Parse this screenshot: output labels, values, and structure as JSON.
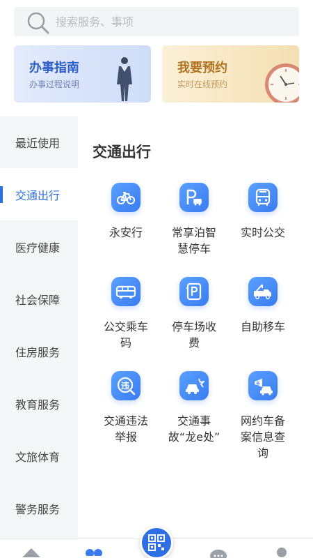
{
  "search": {
    "placeholder": "搜索服务、事项"
  },
  "banners": {
    "guide": {
      "title": "办事指南",
      "subtitle": "办事过程说明"
    },
    "booking": {
      "title": "我要预约",
      "subtitle": "实时在线预约"
    }
  },
  "sidebar": {
    "items": [
      {
        "label": "最近使用"
      },
      {
        "label": "交通出行",
        "active": true
      },
      {
        "label": "医疗健康"
      },
      {
        "label": "社会保障"
      },
      {
        "label": "住房服务"
      },
      {
        "label": "教育服务"
      },
      {
        "label": "文旅体育"
      },
      {
        "label": "警务服务"
      }
    ]
  },
  "main": {
    "section_title": "交通出行",
    "services": [
      {
        "label": "永安行",
        "icon": "bicycle-icon"
      },
      {
        "label": "常享泊智慧停车",
        "icon": "parking-icon"
      },
      {
        "label": "实时公交",
        "icon": "bus-icon"
      },
      {
        "label": "公交乘车码",
        "icon": "bus-side-icon"
      },
      {
        "label": "停车场收费",
        "icon": "parking-fee-icon"
      },
      {
        "label": "自助移车",
        "icon": "tow-truck-icon"
      },
      {
        "label": "交通违法举报",
        "icon": "violation-icon"
      },
      {
        "label": "交通事故“龙e处”",
        "icon": "accident-icon"
      },
      {
        "label": "网约车备案信息查询",
        "icon": "ride-hailing-icon"
      }
    ]
  },
  "tabbar": {
    "icons": [
      "home-icon",
      "grid-icon",
      "qr-code-icon",
      "chat-icon",
      "user-icon"
    ]
  },
  "colors": {
    "accent": "#2b6ee0",
    "icon_blue": "#3a7cf0"
  }
}
